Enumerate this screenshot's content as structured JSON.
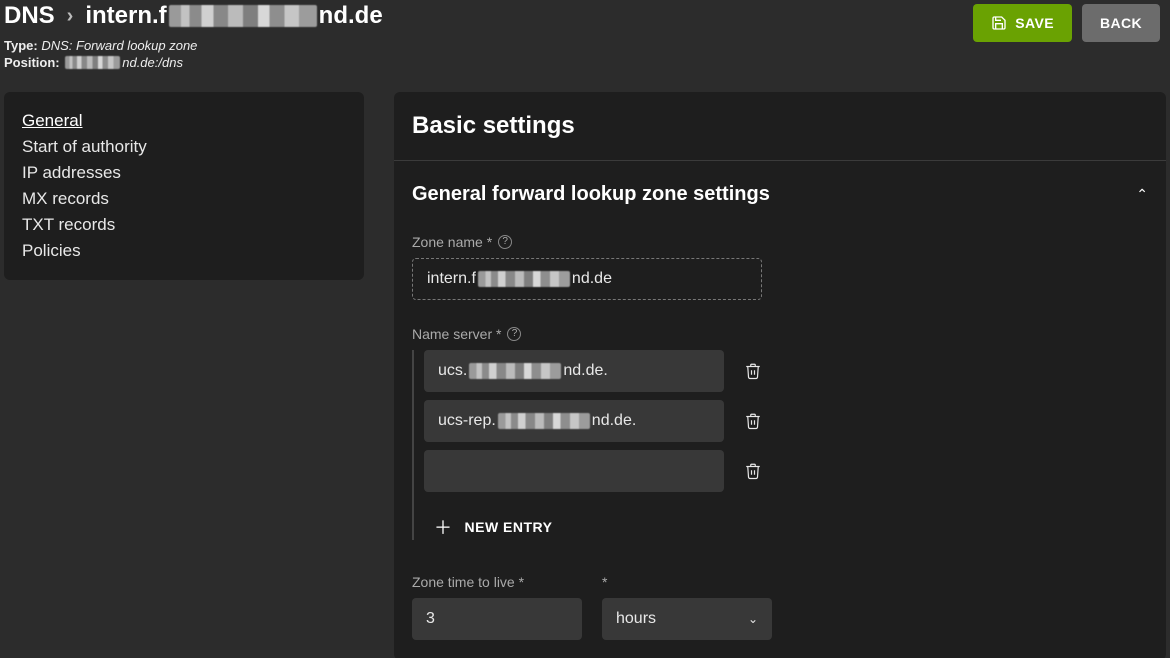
{
  "breadcrumb": {
    "root": "DNS",
    "zone_prefix": "intern.f",
    "zone_suffix": "nd.de"
  },
  "meta": {
    "type_label": "Type:",
    "type_value": "DNS: Forward lookup zone",
    "position_label": "Position:",
    "position_suffix": "nd.de:/dns"
  },
  "buttons": {
    "save": "SAVE",
    "back": "BACK"
  },
  "sidebar": {
    "items": [
      "General",
      "Start of authority",
      "IP addresses",
      "MX records",
      "TXT records",
      "Policies"
    ],
    "active_index": 0
  },
  "main": {
    "title": "Basic settings",
    "section_title": "General forward lookup zone settings",
    "zone_name_label": "Zone name *",
    "zone_name_prefix": "intern.f",
    "zone_name_suffix": "nd.de",
    "ns_label": "Name server *",
    "ns": [
      {
        "prefix": "ucs.",
        "suffix": "nd.de."
      },
      {
        "prefix": "ucs-rep.",
        "suffix": "nd.de."
      },
      {
        "prefix": "",
        "suffix": ""
      }
    ],
    "new_entry": "NEW ENTRY",
    "ttl_label": "Zone time to live *",
    "ttl_value": "3",
    "ttl_unit": "hours",
    "required_marker": "*"
  }
}
